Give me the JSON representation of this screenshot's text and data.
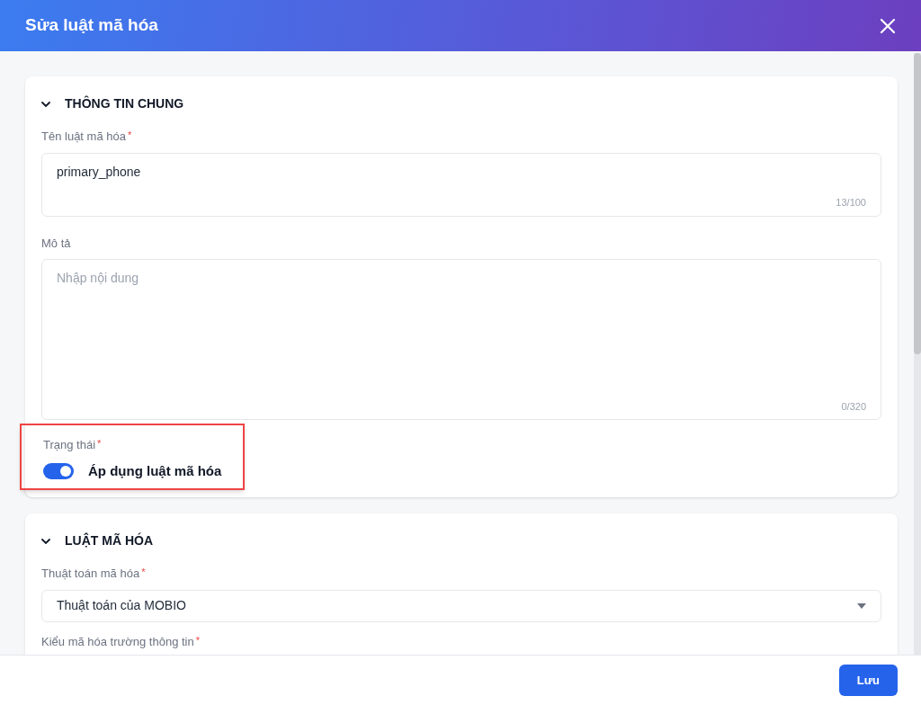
{
  "dialog": {
    "title": "Sửa luật mã hóa"
  },
  "sections": [
    {
      "title": "THÔNG TIN CHUNG",
      "expanded": true,
      "fields": [
        {
          "kind": "text",
          "label": "Tên luật mã hóa",
          "required_mark": "*",
          "value": "primary_phone",
          "counter": "13/100"
        },
        {
          "kind": "textarea",
          "label": "Mô tả",
          "placeholder": "Nhập nội dung",
          "counter": "0/320"
        },
        {
          "kind": "toggle",
          "label": "Trạng thái",
          "required_mark": "*",
          "on": true,
          "text": "Áp dụng luật mã hóa",
          "highlighted": true
        }
      ]
    },
    {
      "title": "LUẬT MÃ HÓA",
      "expanded": true,
      "fields": [
        {
          "kind": "select",
          "label": "Thuật toán mã hóa",
          "required_mark": "*",
          "value": "Thuật toán của MOBIO"
        },
        {
          "kind": "label",
          "label": "Kiểu mã hóa trường thông tin",
          "required_mark": "*"
        }
      ]
    }
  ],
  "footer": {
    "save_button": "Lưu"
  }
}
